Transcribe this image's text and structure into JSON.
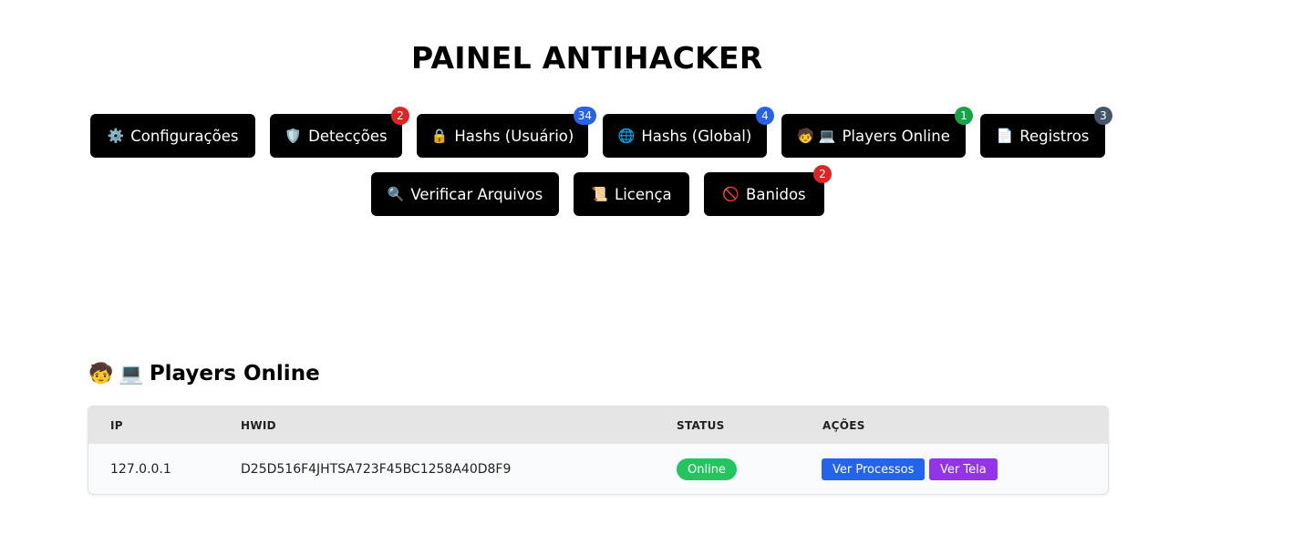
{
  "title": "PAINEL ANTIHACKER",
  "nav": {
    "config": {
      "label": "Configurações",
      "icon": "⚙️"
    },
    "deteccoes": {
      "label": "Detecções",
      "icon": "🛡️",
      "badge": "2"
    },
    "hashs_usuario": {
      "label": "Hashs (Usuário)",
      "icon": "🔒",
      "badge": "34"
    },
    "hashs_global": {
      "label": "Hashs (Global)",
      "icon": "🌐",
      "badge": "4"
    },
    "players_online": {
      "label": "Players Online",
      "icon": "🧒",
      "icon2": "💻",
      "badge": "1"
    },
    "registros": {
      "label": "Registros",
      "icon": "📄",
      "badge": "3"
    },
    "verificar": {
      "label": "Verificar Arquivos",
      "icon": "🔍"
    },
    "licenca": {
      "label": "Licença",
      "icon": "📜"
    },
    "banidos": {
      "label": "Banidos",
      "icon": "🚫",
      "badge": "2"
    }
  },
  "badge_colors": {
    "red": "#dc2626",
    "blue": "#2563eb",
    "green": "#16a34a",
    "gray": "#475569"
  },
  "section": {
    "title": "Players Online",
    "icon": "🧒",
    "icon2": "💻"
  },
  "table": {
    "headers": {
      "ip": "IP",
      "hwid": "HWID",
      "status": "STATUS",
      "acoes": "AÇÕES"
    },
    "rows": [
      {
        "ip": "127.0.0.1",
        "hwid": "D25D516F4JHTSA723F45BC1258A40D8F9",
        "status": "Online",
        "ver_processos": "Ver Processos",
        "ver_tela": "Ver Tela"
      }
    ]
  }
}
